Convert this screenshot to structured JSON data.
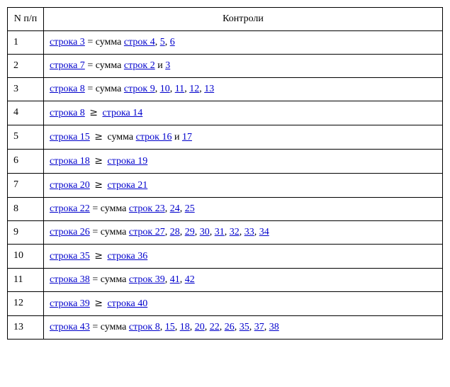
{
  "headers": {
    "num": "N п/п",
    "controls": "Контроли"
  },
  "rows": [
    {
      "n": "1",
      "parts": [
        {
          "t": "link",
          "v": "строка 3"
        },
        {
          "t": "text",
          "v": " = сумма "
        },
        {
          "t": "link",
          "v": "строк 4"
        },
        {
          "t": "text",
          "v": ", "
        },
        {
          "t": "link",
          "v": "5"
        },
        {
          "t": "text",
          "v": ", "
        },
        {
          "t": "link",
          "v": "6"
        }
      ]
    },
    {
      "n": "2",
      "parts": [
        {
          "t": "link",
          "v": "строка 7"
        },
        {
          "t": "text",
          "v": " = сумма "
        },
        {
          "t": "link",
          "v": "строк 2"
        },
        {
          "t": "text",
          "v": " и "
        },
        {
          "t": "link",
          "v": "3"
        }
      ]
    },
    {
      "n": "3",
      "parts": [
        {
          "t": "link",
          "v": "строка 8"
        },
        {
          "t": "text",
          "v": " = сумма "
        },
        {
          "t": "link",
          "v": "строк 9"
        },
        {
          "t": "text",
          "v": ", "
        },
        {
          "t": "link",
          "v": "10"
        },
        {
          "t": "text",
          "v": ", "
        },
        {
          "t": "link",
          "v": "11"
        },
        {
          "t": "text",
          "v": ", "
        },
        {
          "t": "link",
          "v": "12"
        },
        {
          "t": "text",
          "v": ", "
        },
        {
          "t": "link",
          "v": "13"
        }
      ]
    },
    {
      "n": "4",
      "parts": [
        {
          "t": "link",
          "v": "строка 8"
        },
        {
          "t": "ge",
          "v": " ≥ "
        },
        {
          "t": "link",
          "v": "строка 14"
        }
      ]
    },
    {
      "n": "5",
      "parts": [
        {
          "t": "link",
          "v": "строка 15"
        },
        {
          "t": "ge",
          "v": " ≥ "
        },
        {
          "t": "text",
          "v": "сумма "
        },
        {
          "t": "link",
          "v": "строк 16"
        },
        {
          "t": "text",
          "v": " и "
        },
        {
          "t": "link",
          "v": "17"
        }
      ]
    },
    {
      "n": "6",
      "parts": [
        {
          "t": "link",
          "v": "строка 18"
        },
        {
          "t": "ge",
          "v": " ≥ "
        },
        {
          "t": "link",
          "v": "строка 19"
        }
      ]
    },
    {
      "n": "7",
      "parts": [
        {
          "t": "link",
          "v": "строка 20"
        },
        {
          "t": "ge",
          "v": " ≥ "
        },
        {
          "t": "link",
          "v": "строка 21"
        }
      ]
    },
    {
      "n": "8",
      "parts": [
        {
          "t": "link",
          "v": "строка 22"
        },
        {
          "t": "text",
          "v": " = сумма "
        },
        {
          "t": "link",
          "v": "строк 23"
        },
        {
          "t": "text",
          "v": ", "
        },
        {
          "t": "link",
          "v": "24"
        },
        {
          "t": "text",
          "v": ", "
        },
        {
          "t": "link",
          "v": "25"
        }
      ]
    },
    {
      "n": "9",
      "parts": [
        {
          "t": "link",
          "v": "строка 26"
        },
        {
          "t": "text",
          "v": " = сумма "
        },
        {
          "t": "link",
          "v": "строк 27"
        },
        {
          "t": "text",
          "v": ", "
        },
        {
          "t": "link",
          "v": "28"
        },
        {
          "t": "text",
          "v": ", "
        },
        {
          "t": "link",
          "v": "29"
        },
        {
          "t": "text",
          "v": ", "
        },
        {
          "t": "link",
          "v": "30"
        },
        {
          "t": "text",
          "v": ", "
        },
        {
          "t": "link",
          "v": "31"
        },
        {
          "t": "text",
          "v": ", "
        },
        {
          "t": "link",
          "v": "32"
        },
        {
          "t": "text",
          "v": ", "
        },
        {
          "t": "link",
          "v": "33"
        },
        {
          "t": "text",
          "v": ", "
        },
        {
          "t": "link",
          "v": "34"
        }
      ]
    },
    {
      "n": "10",
      "parts": [
        {
          "t": "link",
          "v": "строка 35"
        },
        {
          "t": "ge",
          "v": " ≥ "
        },
        {
          "t": "link",
          "v": "строка 36"
        }
      ]
    },
    {
      "n": "11",
      "parts": [
        {
          "t": "link",
          "v": "строка 38"
        },
        {
          "t": "text",
          "v": " = сумма "
        },
        {
          "t": "link",
          "v": "строк 39"
        },
        {
          "t": "text",
          "v": ", "
        },
        {
          "t": "link",
          "v": "41"
        },
        {
          "t": "text",
          "v": ", "
        },
        {
          "t": "link",
          "v": "42"
        }
      ]
    },
    {
      "n": "12",
      "parts": [
        {
          "t": "link",
          "v": "строка 39"
        },
        {
          "t": "ge",
          "v": " ≥ "
        },
        {
          "t": "link",
          "v": "строка 40"
        }
      ]
    },
    {
      "n": "13",
      "parts": [
        {
          "t": "link",
          "v": "строка 43"
        },
        {
          "t": "text",
          "v": " = сумма "
        },
        {
          "t": "link",
          "v": "строк 8"
        },
        {
          "t": "text",
          "v": ", "
        },
        {
          "t": "link",
          "v": "15"
        },
        {
          "t": "text",
          "v": ", "
        },
        {
          "t": "link",
          "v": "18"
        },
        {
          "t": "text",
          "v": ", "
        },
        {
          "t": "link",
          "v": "20"
        },
        {
          "t": "text",
          "v": ", "
        },
        {
          "t": "link",
          "v": "22"
        },
        {
          "t": "text",
          "v": ", "
        },
        {
          "t": "link",
          "v": "26"
        },
        {
          "t": "text",
          "v": ", "
        },
        {
          "t": "link",
          "v": "35"
        },
        {
          "t": "text",
          "v": ", "
        },
        {
          "t": "link",
          "v": "37"
        },
        {
          "t": "text",
          "v": ", "
        },
        {
          "t": "link",
          "v": "38"
        }
      ]
    }
  ]
}
